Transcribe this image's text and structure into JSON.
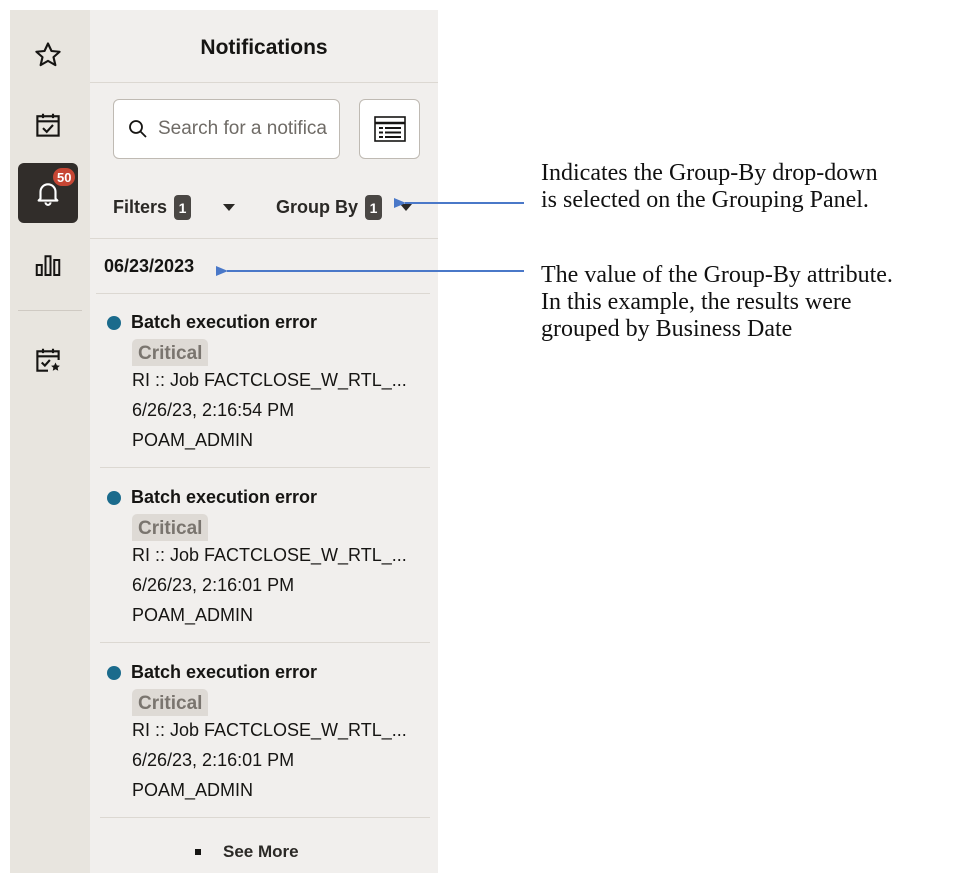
{
  "rail": {
    "items": [
      {
        "icon": "star-icon"
      },
      {
        "icon": "calendar-check-icon"
      },
      {
        "icon": "bell-icon",
        "badge": "50",
        "active": true
      },
      {
        "icon": "bar-chart-icon"
      },
      {
        "icon": "calendar-star-icon"
      }
    ]
  },
  "panel": {
    "title": "Notifications",
    "search_placeholder": "Search for a notifica",
    "filters_label": "Filters",
    "filters_count": "1",
    "group_by_label": "Group By",
    "group_by_count": "1",
    "group_value": "06/23/2023",
    "notifications": [
      {
        "title": "Batch execution error",
        "severity": "Critical",
        "message": "RI :: Job FACTCLOSE_W_RTL_...",
        "timestamp": "6/26/23, 2:16:54 PM",
        "user": "POAM_ADMIN"
      },
      {
        "title": "Batch execution error",
        "severity": "Critical",
        "message": "RI :: Job FACTCLOSE_W_RTL_...",
        "timestamp": "6/26/23, 2:16:01 PM",
        "user": "POAM_ADMIN"
      },
      {
        "title": "Batch execution error",
        "severity": "Critical",
        "message": "RI :: Job FACTCLOSE_W_RTL_...",
        "timestamp": "6/26/23, 2:16:01 PM",
        "user": "POAM_ADMIN"
      }
    ],
    "see_more": "See More"
  },
  "callouts": {
    "group_by": {
      "line1": "Indicates the Group-By drop-down",
      "line2": "is selected on the Grouping Panel."
    },
    "group_value": {
      "line1": "The value of the Group-By attribute.",
      "line2": "In this example, the results were",
      "line3": "grouped by Business Date"
    }
  },
  "colors": {
    "accent_blue_dot": "#1b6b8c",
    "badge_red": "#c74634",
    "arrow_blue": "#4a78c8",
    "panel_bg": "#f1efed",
    "rail_bg": "#e8e5df"
  }
}
